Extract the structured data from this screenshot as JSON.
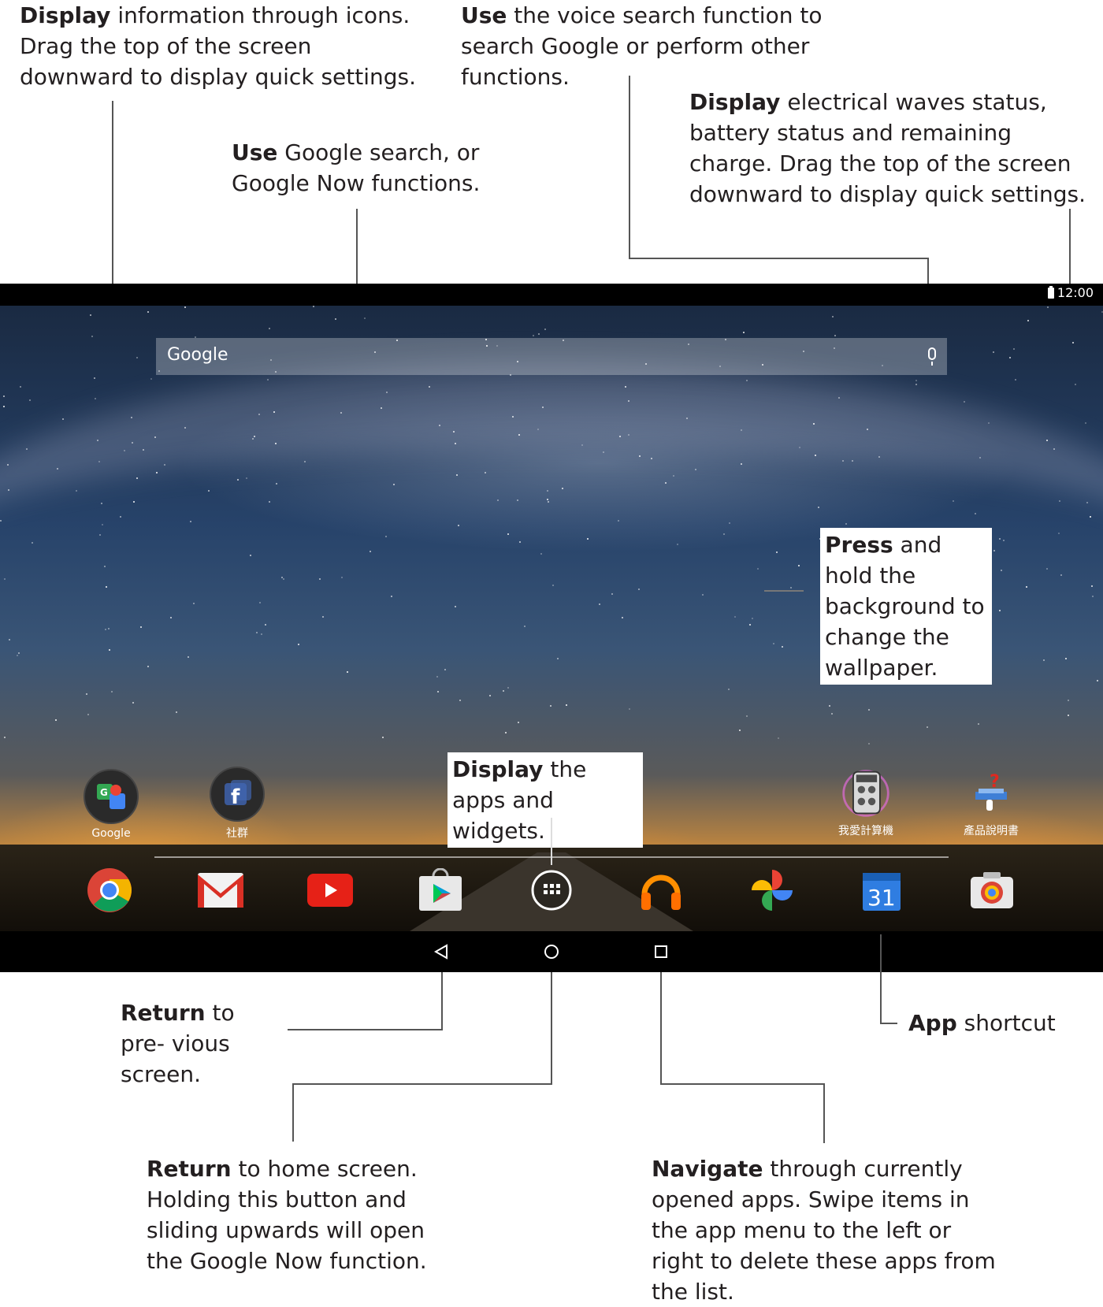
{
  "callouts": {
    "status_icons": {
      "bold": "Display",
      "text": " information through icons. Drag the top of the screen downward to display quick settings."
    },
    "voice_search": {
      "bold": "Use",
      "text": " the voice search function to search Google or perform other functions."
    },
    "google_search": {
      "bold": "Use",
      "text": " Google search, or Google Now functions."
    },
    "battery_status": {
      "bold": "Display",
      "text": " electrical waves status, battery status and remaining charge. Drag the top of the screen downward to display quick settings."
    },
    "wallpaper": {
      "bold": "Press",
      "text": " and hold the background to change the wallpaper."
    },
    "apps_widgets": {
      "bold": "Display",
      "text": " the apps and widgets."
    },
    "back": {
      "bold": "Return",
      "text": " to pre- vious screen."
    },
    "app_shortcut": {
      "bold": "App",
      "text": " shortcut"
    },
    "home": {
      "bold": "Return",
      "text": " to home screen. Holding this button and sliding upwards will open the Google Now function."
    },
    "recents": {
      "bold": "Navigate",
      "text": " through currently opened apps. Swipe items in the app menu to the left or right to delete these apps from the list."
    }
  },
  "status_bar": {
    "time": "12:00",
    "icon": "battery-icon"
  },
  "search_bar": {
    "logo_text": "Google",
    "icon": "mic-icon"
  },
  "desktop_icons": [
    {
      "label": "Google",
      "icon": "google-folder-icon"
    },
    {
      "label": "社群",
      "icon": "social-folder-icon"
    },
    {
      "label": "我愛計算機",
      "icon": "calculator-icon"
    },
    {
      "label": "產品說明書",
      "icon": "manual-icon"
    }
  ],
  "dock_icons": [
    "chrome-icon",
    "gmail-icon",
    "youtube-icon",
    "play-store-icon",
    "app-drawer-icon",
    "play-music-icon",
    "photos-icon",
    "calendar-icon",
    "camera-icon"
  ],
  "calendar_day": "31",
  "nav_icons": [
    "back-icon",
    "home-icon",
    "recents-icon"
  ],
  "colors": {
    "status_bar": "#000000",
    "nav_bar": "#000000",
    "callout_line": "#555555"
  }
}
